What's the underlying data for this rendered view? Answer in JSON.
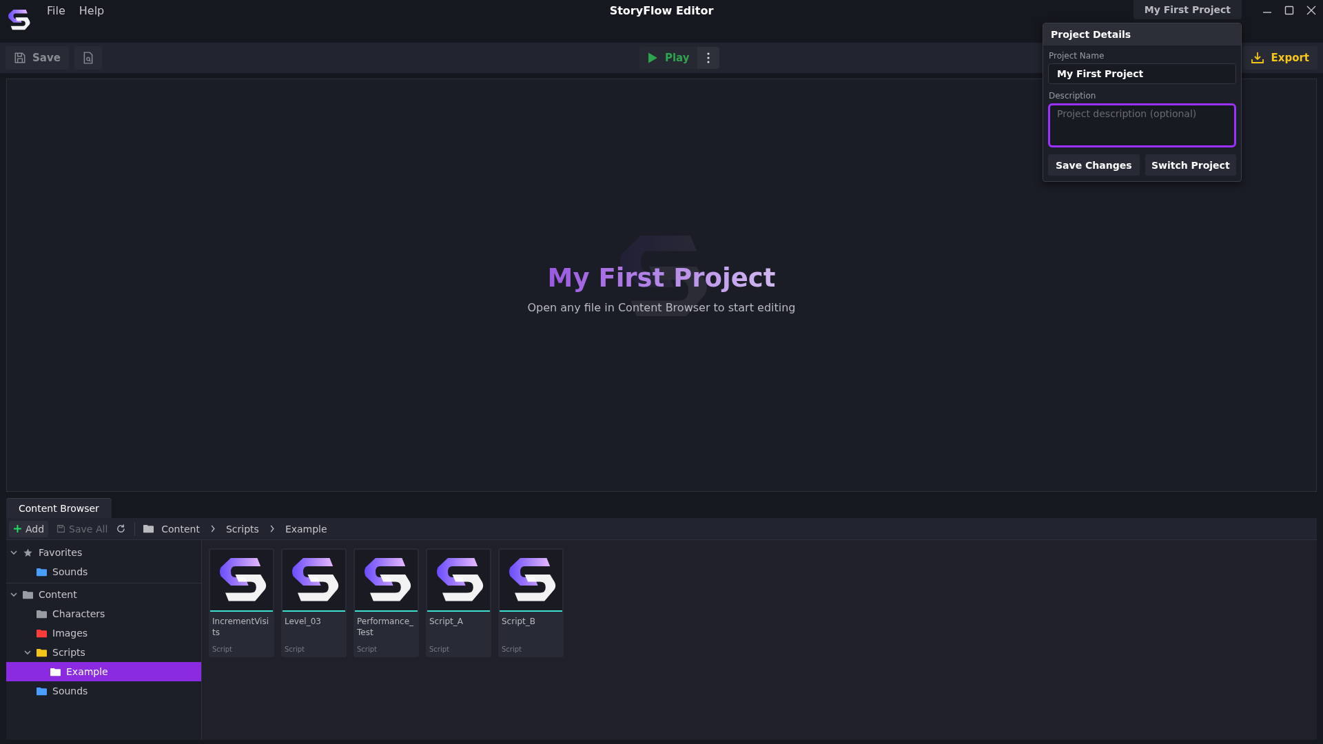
{
  "app": {
    "title": "StoryFlow Editor",
    "menu": [
      "File",
      "Help"
    ],
    "project_button": "My First Project"
  },
  "toolbar": {
    "save": "Save",
    "play": "Play",
    "export": "Export"
  },
  "canvas": {
    "title": "My First Project",
    "hint": "Open any file in Content Browser to start editing"
  },
  "project_details": {
    "title": "Project Details",
    "name_label": "Project Name",
    "name_value": "My First Project",
    "description_label": "Description",
    "description_placeholder": "Project description (optional)",
    "description_focused": true,
    "buttons": [
      "Save Changes",
      "Switch Project"
    ]
  },
  "content_browser": {
    "tab": "Content Browser",
    "add": "Add",
    "save_all": "Save All",
    "save_all_disabled": true,
    "breadcrumb": [
      "Content",
      "Scripts",
      "Example"
    ],
    "tree": [
      {
        "label": "Favorites",
        "kind": "star",
        "expanded": true,
        "selected": false,
        "children": [
          {
            "label": "Sounds",
            "kind": "folder",
            "color": "#4a9eff",
            "selected": false
          }
        ]
      },
      {
        "label": "Content",
        "kind": "folder",
        "color": "#9a9ca4",
        "expanded": true,
        "selected": false,
        "children": [
          {
            "label": "Characters",
            "kind": "folder",
            "color": "#9a9ca4",
            "selected": false
          },
          {
            "label": "Images",
            "kind": "folder",
            "color": "#ff3b3b",
            "selected": false
          },
          {
            "label": "Scripts",
            "kind": "folder",
            "color": "#f5c518",
            "expanded": true,
            "selected": false,
            "children": [
              {
                "label": "Example",
                "kind": "folder",
                "color": "#ffffff",
                "selected": true
              }
            ]
          },
          {
            "label": "Sounds",
            "kind": "folder",
            "color": "#4a9eff",
            "selected": false
          }
        ]
      }
    ],
    "files": [
      {
        "name": "IncrementVisits",
        "type": "Script"
      },
      {
        "name": "Level_03",
        "type": "Script"
      },
      {
        "name": "Performance_Test",
        "type": "Script"
      },
      {
        "name": "Script_A",
        "type": "Script"
      },
      {
        "name": "Script_B",
        "type": "Script"
      }
    ]
  }
}
